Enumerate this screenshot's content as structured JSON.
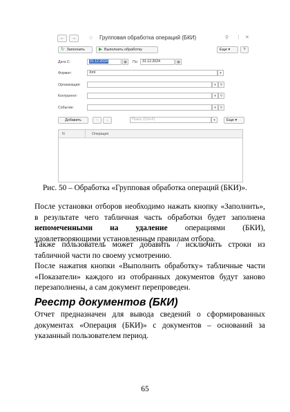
{
  "window": {
    "title": "Групповая обработка операций (БКИ)",
    "fill_label": "Заполнить",
    "run_label": "Выполнить обработку",
    "more_label": "Еще",
    "date_from_label": "Дата С:",
    "date_from_value": "01.12.2024",
    "date_to_label": "По:",
    "date_to_value": "31.12.2024",
    "format_label": "Формат:",
    "format_value": "Xml",
    "org_label": "Организация:",
    "counterparty_label": "Контрагент:",
    "event_label": "Событие:",
    "add_label": "Добавить",
    "search_placeholder": "Поиск (Ctrl+F)",
    "more2_label": "Еще",
    "columns": [
      "N",
      "Операция"
    ]
  },
  "caption": "Рис. 50 – Обработка «Групповая обработка операций (БКИ)».",
  "p1_a": "После установки отборов необходимо нажать кнопку «Заполнить», в результате чего табличная часть обработки будет заполнена ",
  "p1_bold": "непомеченными на удаление",
  "p1_b": " операциями (БКИ), удовлетворяющими установленным правилам отбора.",
  "p2": "Также пользователь может добавить / исключить строки из табличной части по своему усмотрению.",
  "p3": "После нажатия кнопки «Выполнить обработку» табличные части «Показатели» каждого из отобранных документов будут заново перезаполнены, а сам документ перепроведен.",
  "heading": "Реестр документов (БКИ)",
  "p4": "Отчет предназначен для вывода сведений о сформированных документах «Операция (БКИ)» с документов – оснований за указанный пользователем период.",
  "page_number": "65"
}
